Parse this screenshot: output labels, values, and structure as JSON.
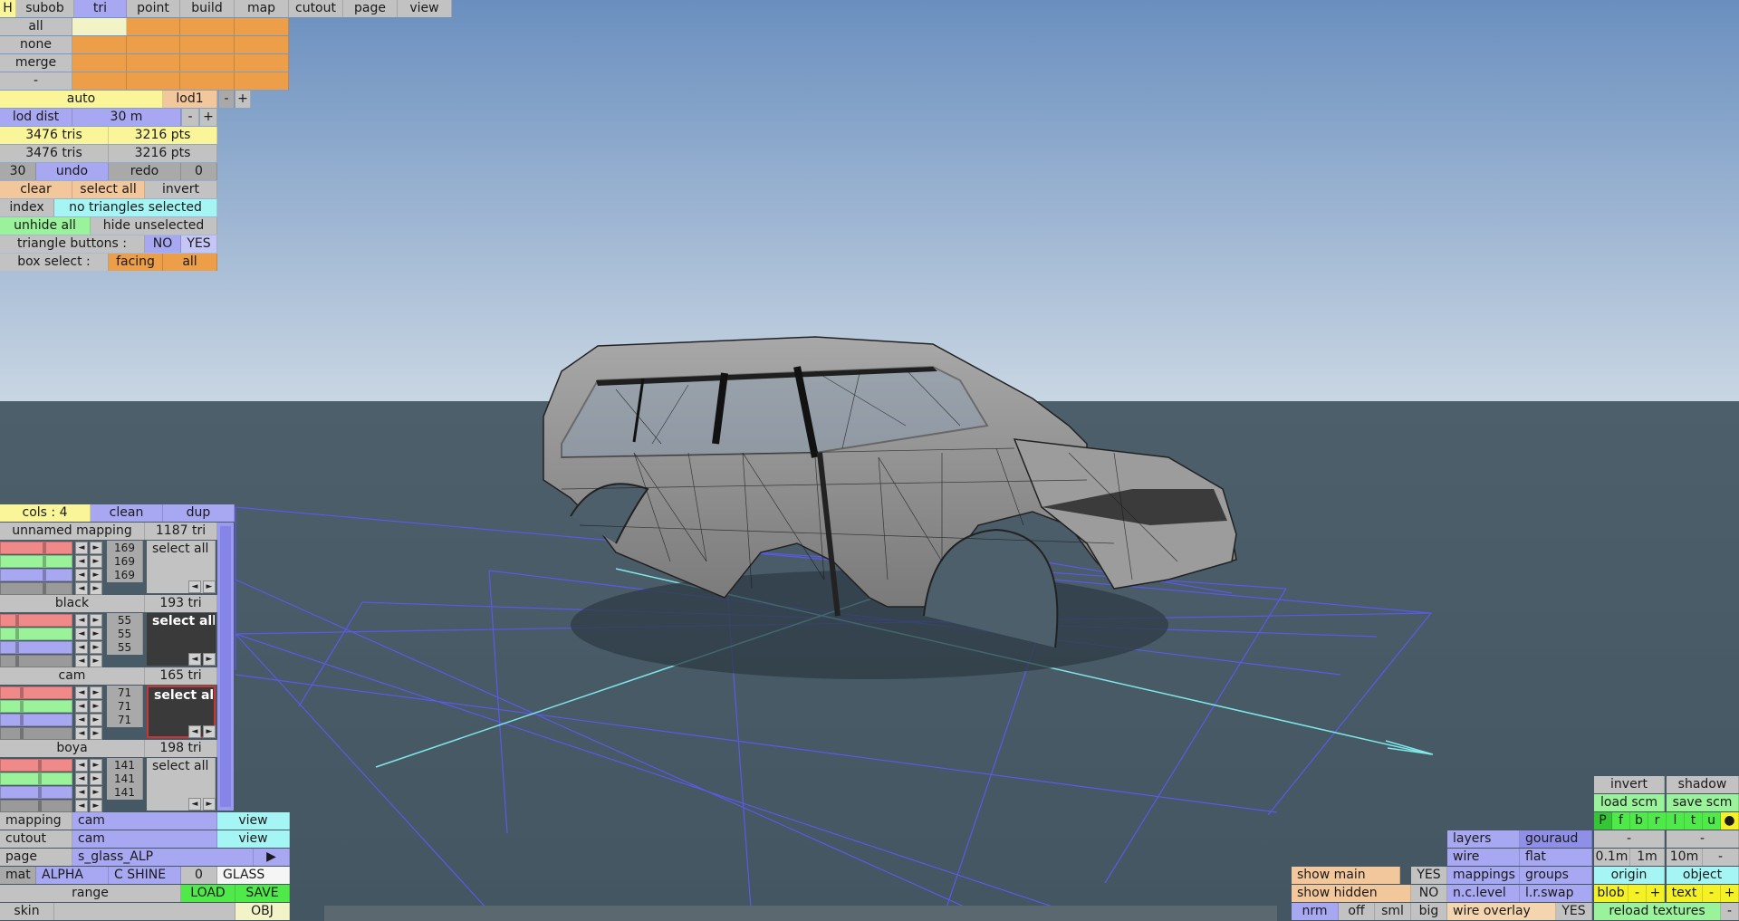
{
  "top_menu": {
    "h": "H",
    "tabs": [
      "subob",
      "tri",
      "point",
      "build",
      "map",
      "cutout",
      "page",
      "view"
    ],
    "active_tab": "tri"
  },
  "select_rows": {
    "labels": [
      "all",
      "none",
      "merge",
      "-"
    ]
  },
  "lod": {
    "auto": "auto",
    "level": "lod1",
    "minus": "-",
    "plus": "+"
  },
  "lod_dist": {
    "label": "lod dist",
    "value": "30 m",
    "minus": "-",
    "plus": "+"
  },
  "stats": {
    "row1": {
      "tris": "3476 tris",
      "pts": "3216 pts"
    },
    "row2": {
      "tris": "3476 tris",
      "pts": "3216 pts"
    }
  },
  "undo": {
    "count": "30",
    "undo": "undo",
    "redo": "redo",
    "redo_count": "0"
  },
  "selection": {
    "clear": "clear",
    "select_all": "select all",
    "invert": "invert"
  },
  "index": {
    "label": "index",
    "status": "no triangles selected"
  },
  "hide": {
    "unhide_all": "unhide all",
    "hide_unselected": "hide unselected"
  },
  "triangle_buttons": {
    "label": "triangle buttons :",
    "no": "NO",
    "yes": "YES"
  },
  "box_select": {
    "label": "box select :",
    "facing": "facing",
    "all": "all"
  },
  "materials_panel": {
    "cols": "cols : 4",
    "clean": "clean",
    "dup": "dup",
    "groups": [
      {
        "name": "unnamed mapping",
        "tri": "1187 tri",
        "values": [
          "169",
          "169",
          "169"
        ],
        "select": "select all",
        "level": 0.62
      },
      {
        "name": "black",
        "tri": "193 tri",
        "values": [
          "55",
          "55",
          "55"
        ],
        "select": "select all",
        "level": 0.22
      },
      {
        "name": "cam",
        "tri": "165 tri",
        "values": [
          "71",
          "71",
          "71"
        ],
        "select": "select all",
        "level": 0.28
      },
      {
        "name": "boya",
        "tri": "198 tri",
        "values": [
          "141",
          "141",
          "141"
        ],
        "select": "select all",
        "level": 0.55
      }
    ],
    "arrow_left": "◄",
    "arrow_right": "►"
  },
  "bottom_left": {
    "mapping": {
      "label": "mapping",
      "value": "cam",
      "view": "view"
    },
    "cutout": {
      "label": "cutout",
      "value": "cam",
      "view": "view"
    },
    "page": {
      "label": "page",
      "value": "s_glass_ALP",
      "arrow": "▶"
    },
    "mat": {
      "label": "mat",
      "alpha": "ALPHA",
      "cshine": "C SHINE",
      "zero": "0",
      "glass": "GLASS"
    },
    "range": {
      "label": "range",
      "load": "LOAD",
      "save": "SAVE"
    },
    "skin": {
      "label": "skin",
      "obj": "OBJ"
    }
  },
  "bottom_right": {
    "invert": "invert",
    "shadow": "shadow",
    "load_scm": "load scm",
    "save_scm": "save scm",
    "view_letters": [
      "P",
      "f",
      "b",
      "r",
      "l",
      "t",
      "u"
    ],
    "dot": "●",
    "layers": "layers",
    "gouraud": "gouraud",
    "dash": "-",
    "wire": "wire",
    "flat": "flat",
    "d01": "0.1m",
    "d1": "1m",
    "d10": "10m",
    "show_main": "show main",
    "show_main_val": "YES",
    "mappings": "mappings",
    "groups": "groups",
    "origin": "origin",
    "object": "object",
    "show_hidden": "show hidden",
    "show_hidden_val": "NO",
    "nclevel": "n.c.level",
    "lrswap": "l.r.swap",
    "blob": "blob",
    "text": "text",
    "plus": "+",
    "nrm": "nrm",
    "off": "off",
    "sml": "sml",
    "big": "big",
    "wire_overlay": "wire overlay",
    "wire_overlay_val": "YES",
    "reload_textures": "reload textures"
  },
  "colors": {
    "sky_top": "#6a8fbf",
    "sky_bottom": "#c9d6e3",
    "ground": "#475a66",
    "grid": "#5a5ae6",
    "axis": "#7fe8e8"
  }
}
